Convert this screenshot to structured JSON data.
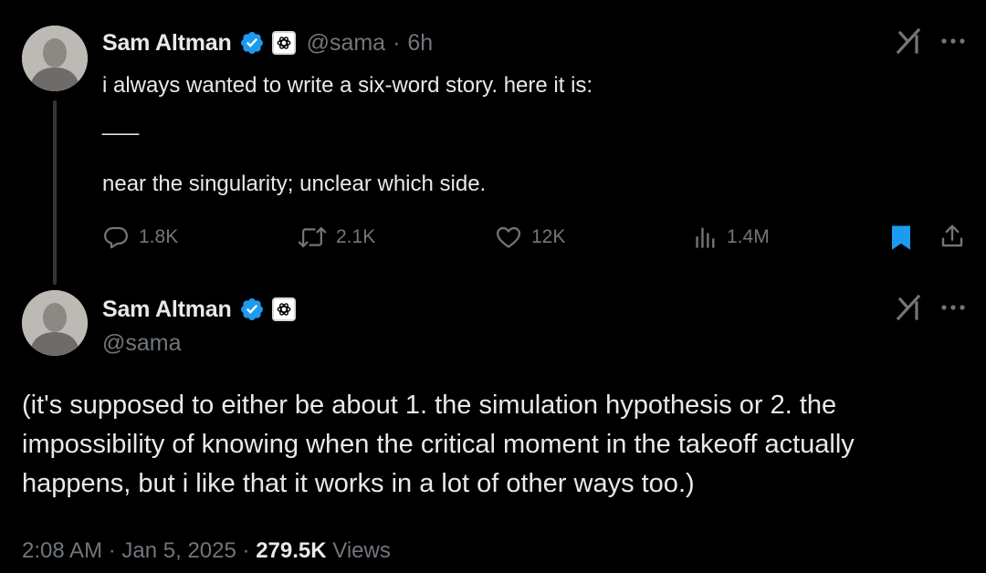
{
  "colors": {
    "background": "#000000",
    "text_primary": "#e7e9ea",
    "text_secondary": "#71767b",
    "verified_blue": "#1d9bf0",
    "bookmark_blue": "#1d9bf0",
    "thread_line": "#333639"
  },
  "tweet": {
    "author_name": "Sam Altman",
    "author_handle": "@sama",
    "separator": "·",
    "time_ago": "6h",
    "lines": [
      "i always wanted to write a six-word story. here it is:",
      "___",
      "near the singularity; unclear which side."
    ],
    "actions": {
      "replies": "1.8K",
      "reposts": "2.1K",
      "likes": "12K",
      "views": "1.4M"
    },
    "icons": {
      "verified": "verified-badge-icon",
      "affiliation": "openai-logo-icon",
      "grok": "grok-icon",
      "more": "more-dots-icon",
      "reply": "reply-icon",
      "repost": "repost-icon",
      "like": "heart-icon",
      "views": "analytics-icon",
      "bookmark": "bookmark-icon",
      "share": "share-icon"
    }
  },
  "reply": {
    "author_name": "Sam Altman",
    "author_handle": "@sama",
    "lines": [
      "(it's supposed to either be about 1. the simulation hypothesis or 2. the",
      "impossibility of knowing when the critical moment in the takeoff actually",
      "happens, but i like that it works in a lot of other ways too.)"
    ],
    "footer": {
      "time": "2:08 AM",
      "separator": "·",
      "date": "Jan 5, 2025",
      "views_count": "279.5K",
      "views_label": "Views"
    }
  }
}
